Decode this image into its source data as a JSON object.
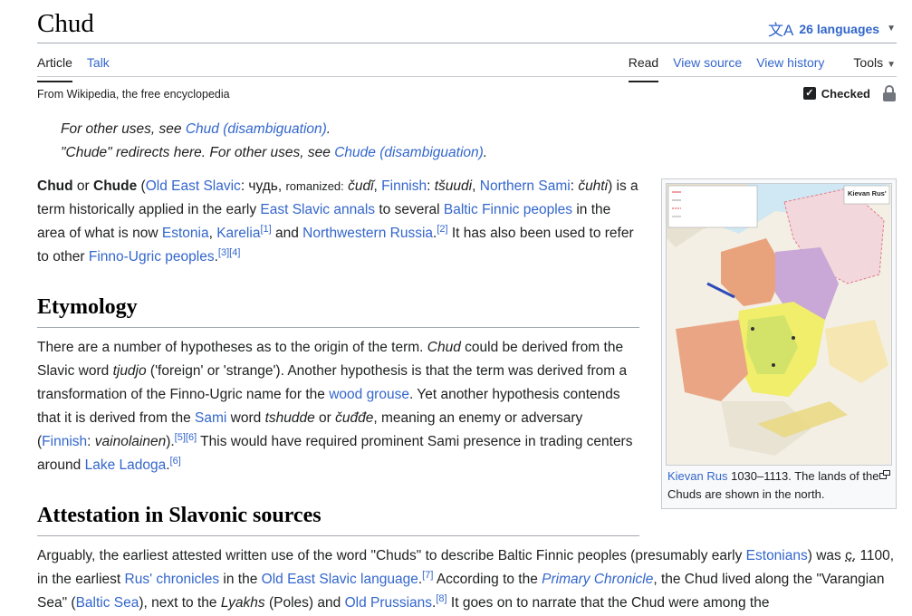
{
  "header": {
    "title": "Chud",
    "languages_label": "26 languages"
  },
  "tabs": {
    "article": "Article",
    "talk": "Talk",
    "read": "Read",
    "view_source": "View source",
    "view_history": "View history",
    "tools": "Tools"
  },
  "tagline": "From Wikipedia, the free encyclopedia",
  "checked_label": "Checked",
  "hatnotes": {
    "h1_prefix": "For other uses, see ",
    "h1_link": "Chud (disambiguation)",
    "h1_suffix": ".",
    "h2_prefix": "\"Chude\" redirects here. For other uses, see ",
    "h2_link": "Chude (disambiguation)",
    "h2_suffix": "."
  },
  "lead": {
    "t1": "Chud",
    "t2": " or ",
    "t3": "Chude",
    "t4": " (",
    "l1": "Old East Slavic",
    "t5": ": чудь, ",
    "t6": "romanized:",
    "t7": " ",
    "t8": "čudĭ",
    "t9": ", ",
    "l2": "Finnish",
    "t10": ": ",
    "t11": "tšuudi",
    "t12": ", ",
    "l3": "Northern Sami",
    "t13": ": ",
    "t14": "čuhti",
    "t15": ") is a term historically applied in the early ",
    "l4": "East Slavic annals",
    "t16": " to several ",
    "l5": "Baltic Finnic peoples",
    "t17": " in the area of what is now ",
    "l6": "Estonia",
    "t18": ", ",
    "l7": "Karelia",
    "r1": "[1]",
    "t19": " and ",
    "l8": "Northwestern Russia",
    "t20": ".",
    "r2": "[2]",
    "t21": " It has also been used to refer to other ",
    "l9": "Finno-Ugric peoples",
    "t22": ".",
    "r3": "[3]",
    "r4": "[4]"
  },
  "etymology": {
    "heading": "Etymology",
    "t1": "There are a number of hypotheses as to the origin of the term. ",
    "t2": "Chud",
    "t3": " could be derived from the Slavic word ",
    "t4": "tjudjo",
    "t5": " ('foreign' or 'strange'). Another hypothesis is that the term was derived from a transformation of the Finno-Ugric name for the ",
    "l1": "wood grouse",
    "t6": ". Yet another hypothesis contends that it is derived from the ",
    "l2": "Sami",
    "t7": " word ",
    "t8": "tshudde",
    "t9": " or ",
    "t10": "čuđđe",
    "t11": ", meaning an enemy or adversary (",
    "l3": "Finnish",
    "t12": ": ",
    "t13": "vainolainen",
    "t14": ").",
    "r1": "[5]",
    "r2": "[6]",
    "t15": " This would have required prominent Sami presence in trading centers around ",
    "l4": "Lake Ladoga",
    "t16": ".",
    "r3": "[6]"
  },
  "attestation": {
    "heading": "Attestation in Slavonic sources",
    "t1": "Arguably, the earliest attested written use of the word \"Chuds\" to describe Baltic Finnic peoples (presumably early ",
    "l1": "Estonians",
    "t2": ") was ",
    "t3": "c.",
    "t4": " 1100, in the earliest ",
    "l2": "Rus' chronicles",
    "t5": " in the ",
    "l3": "Old East Slavic language",
    "t6": ".",
    "r1": "[7]",
    "t7": " According to the ",
    "l4": "Primary Chronicle",
    "t8": ", the Chud lived along the \"Varangian Sea\" (",
    "l5": "Baltic Sea",
    "t9": "), next to the ",
    "t10": "Lyakhs",
    "t11": " (Poles) and ",
    "l6": "Old Prussians",
    "t12": ".",
    "r2": "[8]",
    "t13": " It goes on to narrate that the Chud were among the"
  },
  "infobox": {
    "map_title": "Kievan Rus'",
    "caption_link": "Kievan Rus",
    "caption_text": " 1030–1113. The lands of the Chuds are shown in the north."
  }
}
